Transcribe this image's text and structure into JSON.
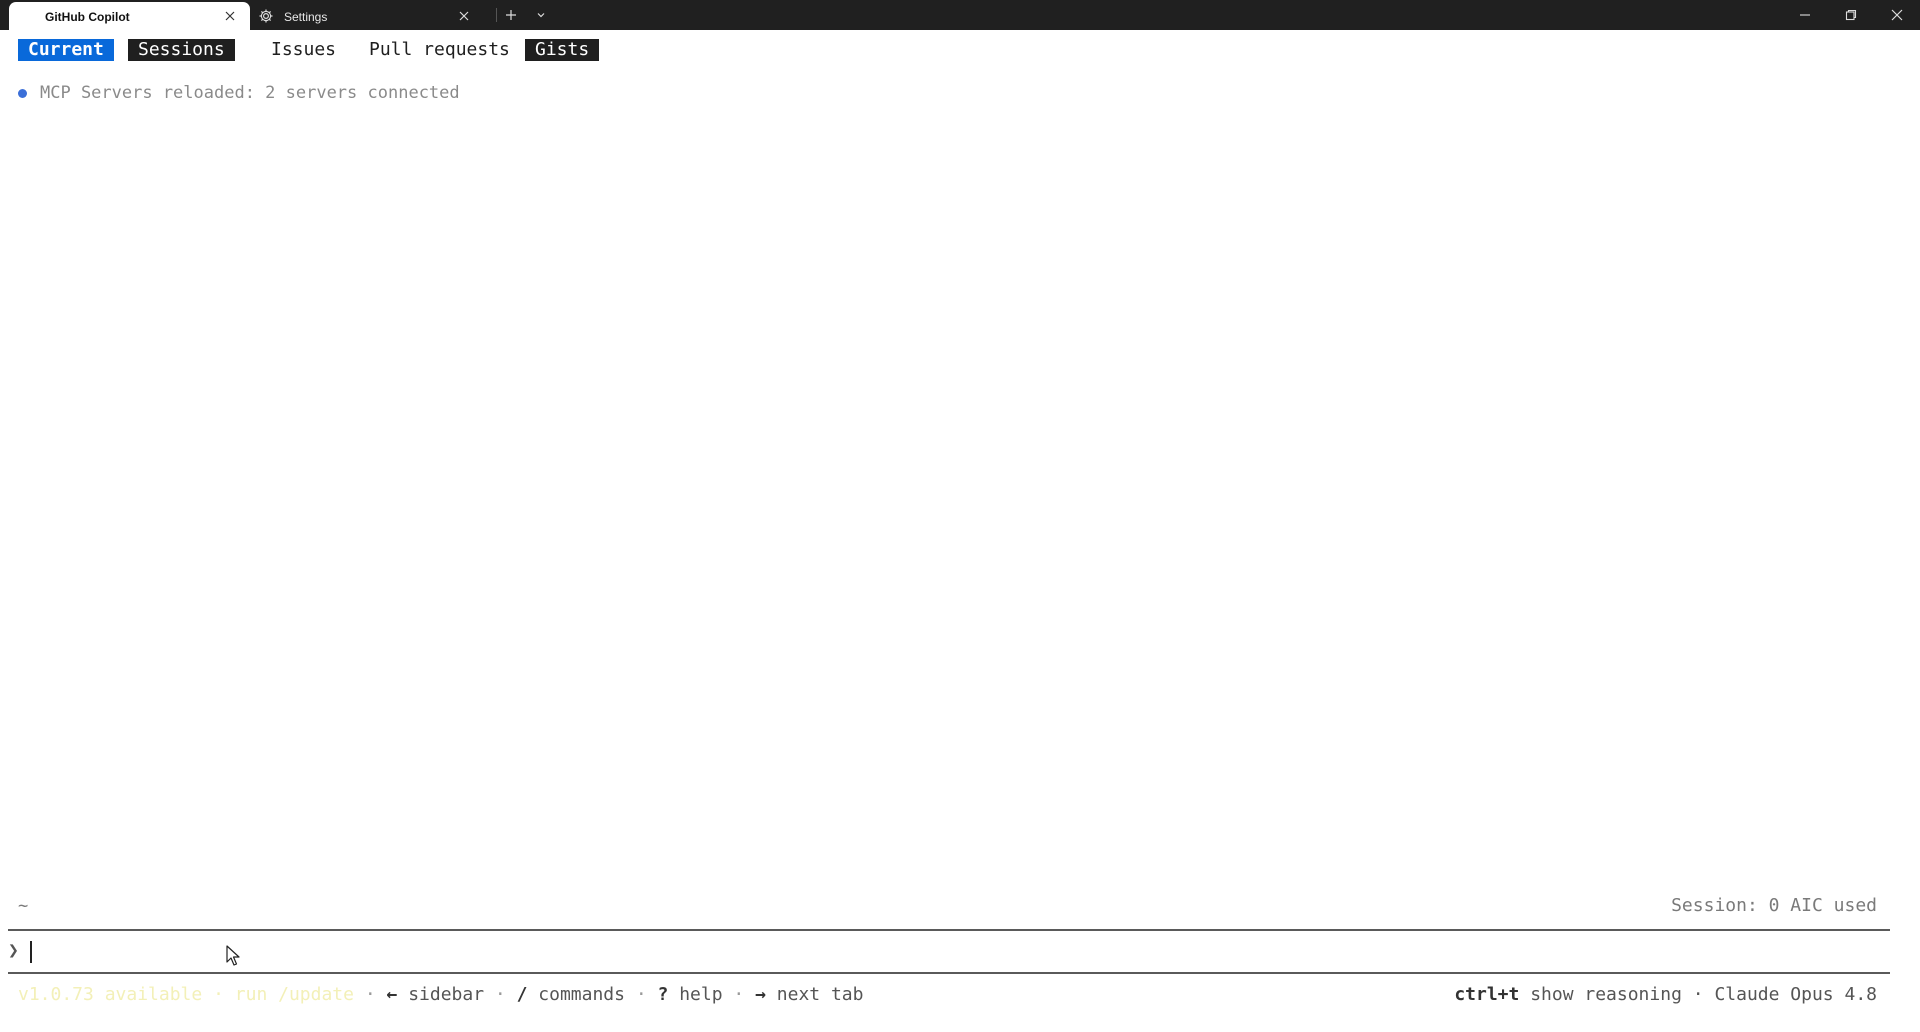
{
  "titlebar": {
    "tabs": [
      {
        "label": "GitHub Copilot",
        "active": true,
        "icon": "none"
      },
      {
        "label": "Settings",
        "active": false,
        "icon": "gear-icon"
      }
    ],
    "new_tab_icon": "plus-icon",
    "tab_menu_icon": "chevron-down-icon",
    "window_controls": [
      "minimize-icon",
      "restore-icon",
      "close-icon"
    ]
  },
  "nav": {
    "tabs": [
      {
        "label": "Current",
        "selected": true
      },
      {
        "label": "Sessions",
        "selected": false
      },
      {
        "label": "Issues",
        "selected": false
      },
      {
        "label": "Pull requests",
        "selected": false
      },
      {
        "label": "Gists",
        "selected": false
      }
    ]
  },
  "status": {
    "message": "MCP Servers reloaded: 2 servers connected",
    "dot_color": "#3b6fd8"
  },
  "prompt": {
    "cwd": "~",
    "session_usage": "Session: 0 AIC used",
    "glyph": "❯",
    "value": "",
    "placeholder": ""
  },
  "footer": {
    "update_available": "v1.0.73 available",
    "sep1": "·",
    "update_cmd": "run /update",
    "sep2": "·",
    "sidebar_key": "←",
    "sidebar_label": "sidebar",
    "sep3": "·",
    "commands_key": "/",
    "commands_label": "commands",
    "sep4": "·",
    "help_key": "?",
    "help_label": "help",
    "sep5": "·",
    "next_tab_key": "→",
    "next_tab_label": "next tab",
    "reasoning_key": "ctrl+t",
    "reasoning_label": "show reasoning",
    "sep6": "·",
    "model": "Claude Opus 4.8"
  },
  "colors": {
    "accent": "#0969da",
    "titlebar_bg": "#202020",
    "update_hint": "#f3f0b8"
  }
}
